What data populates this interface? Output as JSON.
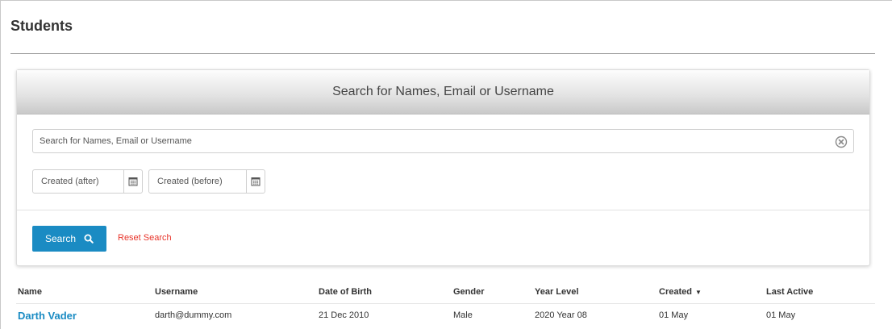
{
  "page": {
    "title": "Students"
  },
  "search": {
    "header": "Search for Names, Email or Username",
    "placeholder": "Search for Names, Email or Username",
    "value": "",
    "clear_icon": "clear-circle-icon",
    "created_after_placeholder": "Created (after)",
    "created_before_placeholder": "Created (before)",
    "calendar_icon": "calendar-icon",
    "search_button_label": "Search",
    "search_button_icon": "search-icon",
    "reset_label": "Reset Search"
  },
  "table": {
    "columns": [
      "Name",
      "Username",
      "Date of Birth",
      "Gender",
      "Year Level",
      "Created",
      "Last Active"
    ],
    "sort_indicator": "▼",
    "sorted_column": "Created",
    "rows": [
      {
        "name": "Darth Vader",
        "username": "darth@dummy.com",
        "dob": "21 Dec 2010",
        "gender": "Male",
        "year_level": "2020 Year 08",
        "created": "01 May",
        "last_active": "01 May"
      }
    ]
  },
  "colors": {
    "accent": "#1a8bc3",
    "reset_link": "#e8352b",
    "header_gradient_top": "#fdfdfd",
    "header_gradient_bottom": "#c9c9c9"
  }
}
